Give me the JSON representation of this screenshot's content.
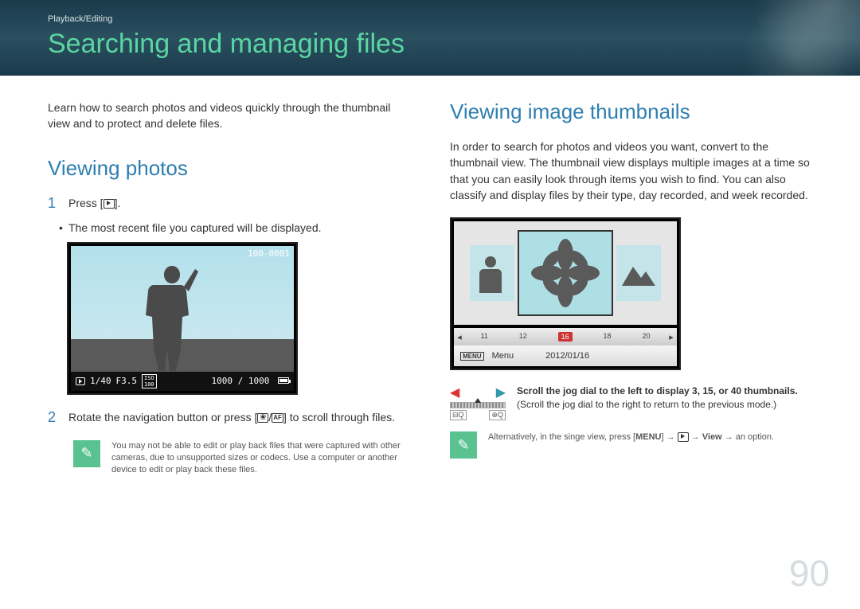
{
  "breadcrumb": "Playback/Editing",
  "page_title": "Searching and managing files",
  "intro": "Learn how to search photos and videos quickly through the thumbnail view and to protect and delete files.",
  "left": {
    "heading": "Viewing photos",
    "step1_num": "1",
    "step1_text_a": "Press [",
    "step1_text_b": "].",
    "step1_bullet": "The most recent file you captured will be displayed.",
    "lcd1": {
      "file_no": "100-0001",
      "shutter": "1/40",
      "fnum": "F3.5",
      "iso_label": "ISO",
      "iso": "100",
      "counter": "1000 / 1000"
    },
    "step2_num": "2",
    "step2_text_a": "Rotate the navigation button or press [",
    "step2_mid": "/",
    "step2_text_b": "] to scroll through files.",
    "note": "You may not be able to edit or play back files that were captured with other cameras, due to unsupported sizes or codecs. Use a computer or another device to edit or play back these files."
  },
  "right": {
    "heading": "Viewing image thumbnails",
    "intro": "In order to search for photos and videos you want, convert to the thumbnail view. The thumbnail view displays multiple images at a time so that you can easily look through items you wish to find. You can also classify and display files by their type, day recorded, and week recorded.",
    "timeline_dates": [
      "11",
      "12",
      "16",
      "18",
      "20"
    ],
    "menu_label": "MENU",
    "menu_text": "Menu",
    "menu_date": "2012/01/16",
    "dial_tip_bold": "Scroll the jog dial to the left to display 3, 15, or 40 thumbnails.",
    "dial_tip_sub": "(Scroll the jog dial to the right to return to the previous mode.)",
    "alt_note_a": "Alternatively, in the singe view, press [",
    "alt_note_menu": "MENU",
    "alt_note_b": "] → ",
    "alt_note_c": " → ",
    "alt_note_view": "View",
    "alt_note_d": " → an option."
  },
  "page_number": "90"
}
